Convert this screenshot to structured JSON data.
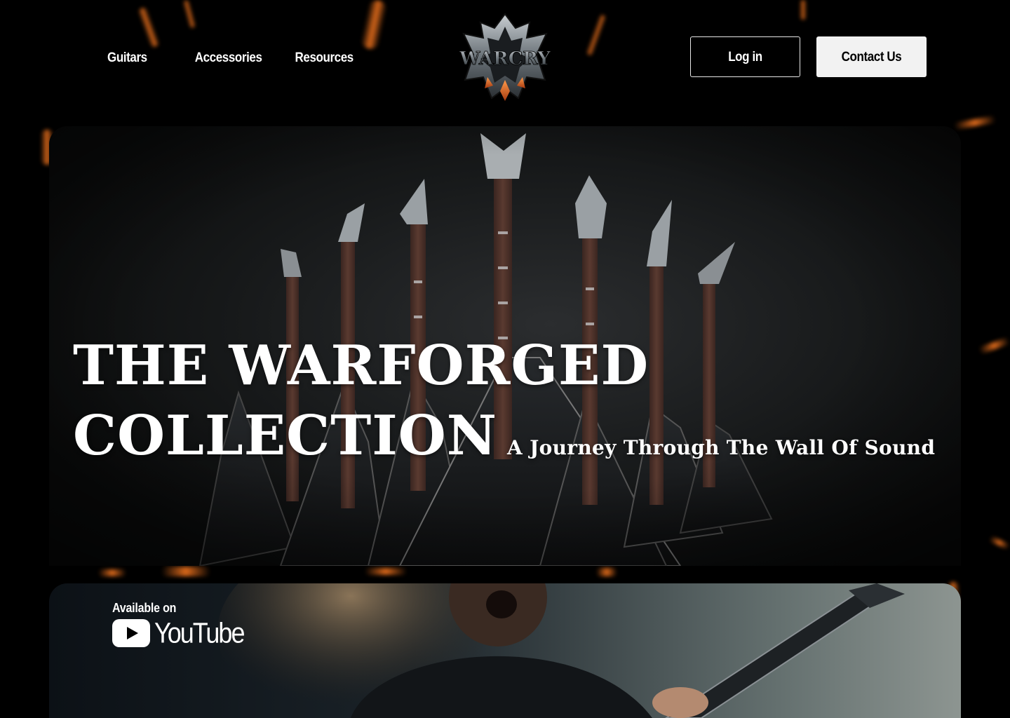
{
  "nav": {
    "items": [
      {
        "label": "Guitars"
      },
      {
        "label": "Accessories"
      },
      {
        "label": "Resources"
      }
    ]
  },
  "brand": {
    "logo_text": "WARCRY",
    "logo_icon": "warcry-emblem-icon"
  },
  "header_buttons": {
    "login_label": "Log in",
    "contact_label": "Contact Us"
  },
  "hero": {
    "title_line1": "THE WARFORGED",
    "title_line2": "COLLECTION",
    "subtitle": "A Journey Through The Wall Of Sound"
  },
  "promo": {
    "available_label": "Available on",
    "platform_name": "YouTube",
    "platform_icon": "youtube-play-icon"
  },
  "colors": {
    "background": "#000000",
    "ember": "#ff7a1f",
    "button_light": "#f2f2f2",
    "youtube_red": "#ffffff"
  }
}
